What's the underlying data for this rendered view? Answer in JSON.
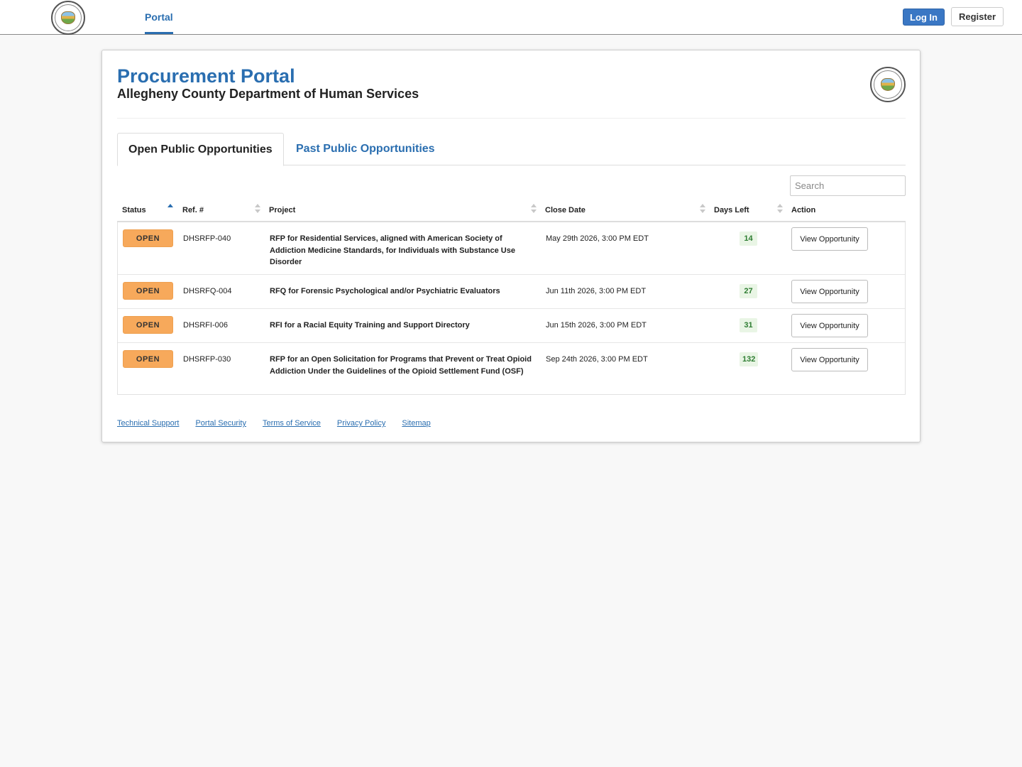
{
  "nav": {
    "tab": "Portal",
    "login_label": "Log In",
    "register_label": "Register"
  },
  "header": {
    "title": "Procurement Portal",
    "subtitle": "Allegheny County Department of Human Services"
  },
  "tabs": [
    {
      "label": "Open Public Opportunities",
      "active": true
    },
    {
      "label": "Past Public Opportunities",
      "active": false
    }
  ],
  "search": {
    "placeholder": "Search"
  },
  "table": {
    "columns": [
      "Status",
      "Ref. #",
      "Project",
      "Close Date",
      "Days Left",
      "Action"
    ],
    "rows": [
      {
        "status": "OPEN",
        "ref": "DHSRFP-040",
        "project": "RFP for Residential Services, aligned with American Society of Addiction Medicine Standards, for Individuals with Substance Use Disorder",
        "close_date": "May 29th 2026, 3:00 PM EDT",
        "days_left": "14",
        "action": "View Opportunity"
      },
      {
        "status": "OPEN",
        "ref": "DHSRFQ-004",
        "project": "RFQ for Forensic Psychological and/or Psychiatric Evaluators",
        "close_date": "Jun 11th 2026, 3:00 PM EDT",
        "days_left": "27",
        "action": "View Opportunity"
      },
      {
        "status": "OPEN",
        "ref": "DHSRFI-006",
        "project": "RFI for a Racial Equity Training and Support Directory",
        "close_date": "Jun 15th 2026, 3:00 PM EDT",
        "days_left": "31",
        "action": "View Opportunity"
      },
      {
        "status": "OPEN",
        "ref": "DHSRFP-030",
        "project": "RFP for an Open Solicitation for Programs that Prevent or Treat Opioid Addiction Under the Guidelines of the Opioid Settlement Fund (OSF)",
        "close_date": "Sep 24th 2026, 3:00 PM EDT",
        "days_left": "132",
        "action": "View Opportunity"
      }
    ]
  },
  "footer": {
    "links": [
      "Technical Support",
      "Portal Security",
      "Terms of Service",
      "Privacy Policy",
      "Sitemap"
    ]
  },
  "colors": {
    "brand_blue": "#2a6eb0",
    "login_blue": "#3a77c4",
    "open_badge": "#f7a95b",
    "days_green": "#2e7d32"
  },
  "icons": {
    "nav_logo": "county-seal-icon",
    "card_logo": "county-seal-icon",
    "sort": "sort-arrows-icon"
  }
}
